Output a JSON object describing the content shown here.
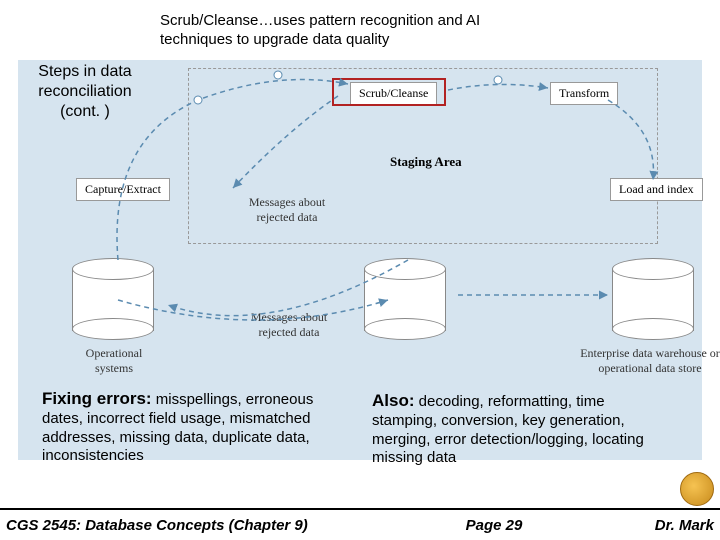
{
  "callout": "Scrub/Cleanse…uses pattern recognition and AI techniques to upgrade data quality",
  "title": "Steps in data reconciliation (cont. )",
  "staging_label": "Staging Area",
  "steps": {
    "capture": "Capture/Extract",
    "scrub": "Scrub/Cleanse",
    "transform": "Transform",
    "load": "Load and index"
  },
  "labels": {
    "operational": "Operational systems",
    "msg1": "Messages about rejected data",
    "msg2": "Messages about rejected data",
    "enterprise": "Enterprise data warehouse or operational data store"
  },
  "left_block": {
    "heading": "Fixing errors:",
    "body": " misspellings, erroneous dates, incorrect field usage, mismatched addresses, missing data, duplicate data, inconsistencies"
  },
  "right_block": {
    "heading": "Also:",
    "body": " decoding, reformatting, time stamping, conversion, key generation, merging, error detection/logging, locating missing data"
  },
  "footer": {
    "course": "CGS 2545: Database Concepts  (Chapter 9)",
    "page": "Page 29",
    "author": "Dr. Mark"
  }
}
